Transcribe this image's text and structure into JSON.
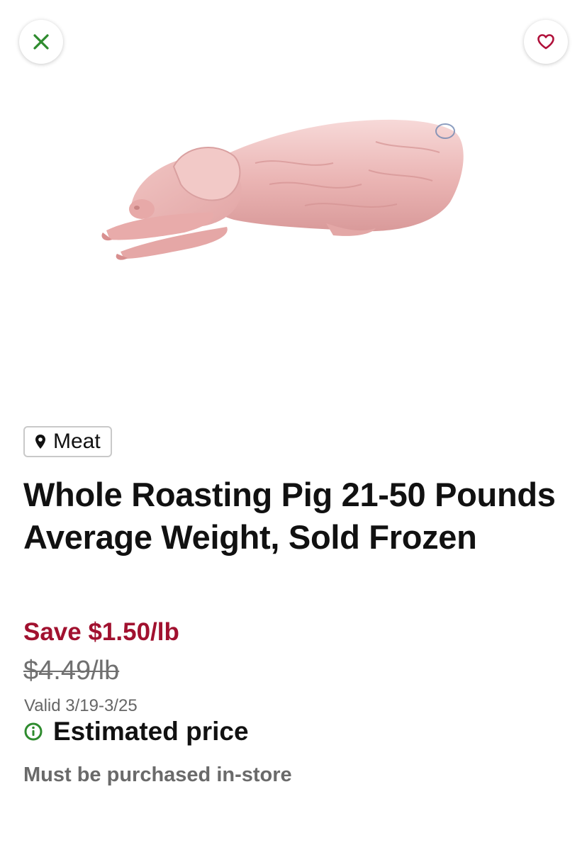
{
  "header": {
    "close_icon": "close-icon",
    "favorite_icon": "heart-icon",
    "close_color": "#2e8b2e",
    "favorite_color": "#b0103a"
  },
  "product": {
    "image_alt": "whole-roasting-pig",
    "department": "Meat",
    "department_icon": "location-pin-icon",
    "title": "Whole Roasting Pig 21-50 Pounds Average Weight, Sold Frozen",
    "save_text": "Save $1.50/lb",
    "original_price": "$4.49/lb",
    "valid_dates": "Valid 3/19-3/25",
    "estimate_icon": "info-icon",
    "estimate_label": "Estimated price",
    "purchase_note": "Must be purchased in-store"
  },
  "colors": {
    "accent_red": "#a1112f",
    "info_green": "#2e8b2e"
  }
}
